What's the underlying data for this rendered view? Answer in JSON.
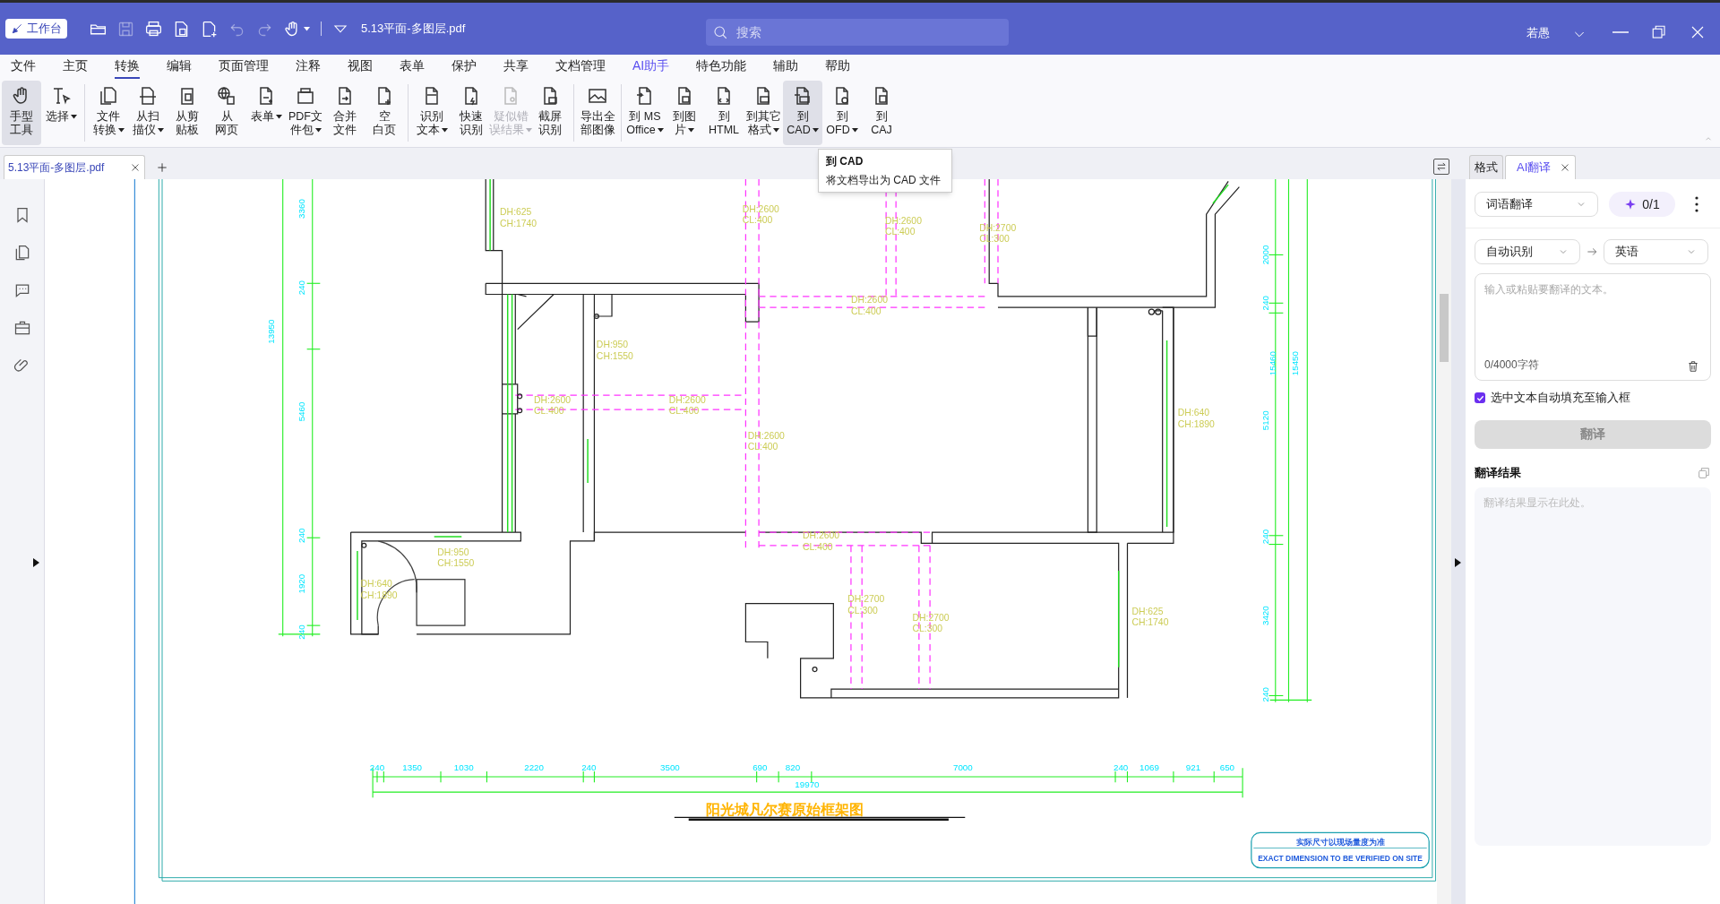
{
  "app": {
    "workbench_button": "工作台",
    "file_name": "5.13平面-多图层.pdf",
    "search": {
      "placeholder": "搜索"
    },
    "user": "若愚"
  },
  "quick_access": [
    {
      "disabled": false
    },
    {
      "disabled": true
    },
    {
      "disabled": false
    },
    {
      "disabled": false
    },
    {
      "disabled": false
    },
    {
      "disabled": true
    },
    {
      "disabled": true
    },
    {
      "disabled": false
    }
  ],
  "menu": [
    {
      "label": "文件",
      "selected": false,
      "accent": false
    },
    {
      "label": "主页",
      "selected": false,
      "accent": false
    },
    {
      "label": "转换",
      "selected": true,
      "accent": false
    },
    {
      "label": "编辑",
      "selected": false,
      "accent": false
    },
    {
      "label": "页面管理",
      "selected": false,
      "accent": false
    },
    {
      "label": "注释",
      "selected": false,
      "accent": false
    },
    {
      "label": "视图",
      "selected": false,
      "accent": false
    },
    {
      "label": "表单",
      "selected": false,
      "accent": false
    },
    {
      "label": "保护",
      "selected": false,
      "accent": false
    },
    {
      "label": "共享",
      "selected": false,
      "accent": false
    },
    {
      "label": "文档管理",
      "selected": false,
      "accent": false
    },
    {
      "label": "AI助手",
      "selected": false,
      "accent": true
    },
    {
      "label": "特色功能",
      "selected": false,
      "accent": false
    },
    {
      "label": "辅助",
      "selected": false,
      "accent": false
    },
    {
      "label": "帮助",
      "selected": false,
      "accent": false
    }
  ],
  "ribbon": [
    {
      "lines": [
        "手型",
        "工具"
      ],
      "caret": false,
      "highlighted": true,
      "disabled": false,
      "separator_before": false
    },
    {
      "lines": [
        "选择"
      ],
      "caret": true,
      "highlighted": false,
      "disabled": false,
      "separator_before": false
    },
    {
      "lines": [
        "文件",
        "转换"
      ],
      "caret": true,
      "highlighted": false,
      "disabled": false,
      "separator_before": true
    },
    {
      "lines": [
        "从扫",
        "描仪"
      ],
      "caret": true,
      "highlighted": false,
      "disabled": false,
      "separator_before": false
    },
    {
      "lines": [
        "从剪",
        "贴板"
      ],
      "caret": false,
      "highlighted": false,
      "disabled": false,
      "separator_before": false
    },
    {
      "lines": [
        "从",
        "网页"
      ],
      "caret": false,
      "highlighted": false,
      "disabled": false,
      "separator_before": false
    },
    {
      "lines": [
        "表单"
      ],
      "caret": true,
      "highlighted": false,
      "disabled": false,
      "separator_before": false
    },
    {
      "lines": [
        "PDF文",
        "件包"
      ],
      "caret": true,
      "highlighted": false,
      "disabled": false,
      "separator_before": false
    },
    {
      "lines": [
        "合并",
        "文件"
      ],
      "caret": false,
      "highlighted": false,
      "disabled": false,
      "separator_before": false
    },
    {
      "lines": [
        "空",
        "白页"
      ],
      "caret": false,
      "highlighted": false,
      "disabled": false,
      "separator_before": false
    },
    {
      "lines": [
        "识别",
        "文本"
      ],
      "caret": true,
      "highlighted": false,
      "disabled": false,
      "separator_before": true
    },
    {
      "lines": [
        "快速",
        "识别"
      ],
      "caret": false,
      "highlighted": false,
      "disabled": false,
      "separator_before": false
    },
    {
      "lines": [
        "疑似错",
        "误结果"
      ],
      "caret": true,
      "highlighted": false,
      "disabled": true,
      "separator_before": false
    },
    {
      "lines": [
        "截屏",
        "识别"
      ],
      "caret": false,
      "highlighted": false,
      "disabled": false,
      "separator_before": false
    },
    {
      "lines": [
        "导出全",
        "部图像"
      ],
      "caret": false,
      "highlighted": false,
      "disabled": false,
      "separator_before": true
    },
    {
      "lines": [
        "到 MS",
        "Office"
      ],
      "caret": true,
      "highlighted": false,
      "disabled": false,
      "separator_before": true
    },
    {
      "lines": [
        "到图",
        "片"
      ],
      "caret": true,
      "highlighted": false,
      "disabled": false,
      "separator_before": false
    },
    {
      "lines": [
        "到",
        "HTML"
      ],
      "caret": false,
      "highlighted": false,
      "disabled": false,
      "separator_before": false
    },
    {
      "lines": [
        "到其它",
        "格式"
      ],
      "caret": true,
      "highlighted": false,
      "disabled": false,
      "separator_before": false
    },
    {
      "lines": [
        "到",
        "CAD"
      ],
      "caret": true,
      "highlighted": true,
      "disabled": false,
      "separator_before": false
    },
    {
      "lines": [
        "到",
        "OFD"
      ],
      "caret": true,
      "highlighted": false,
      "disabled": false,
      "separator_before": false
    },
    {
      "lines": [
        "到",
        "CAJ"
      ],
      "caret": false,
      "highlighted": false,
      "disabled": false,
      "separator_before": false
    }
  ],
  "tooltip": {
    "title": "到 CAD",
    "text": "将文档导出为 CAD 文件"
  },
  "document_tabs": [
    {
      "label": "5.13平面-多图层.pdf",
      "selected": true
    }
  ],
  "drawing": {
    "annotations": [
      {
        "lines": [
          "DH:625",
          "CH:1740"
        ]
      },
      {
        "lines": [
          "DH:2600",
          "CL:400"
        ]
      },
      {
        "lines": [
          "DH:2600",
          "CL:400"
        ]
      },
      {
        "lines": [
          "DH:2700",
          "CL:300"
        ]
      },
      {
        "lines": [
          "DH:2600",
          "CL:400"
        ]
      },
      {
        "lines": [
          "DH:950",
          "CH:1550"
        ]
      },
      {
        "lines": [
          "DH:2600",
          "CL:400"
        ]
      },
      {
        "lines": [
          "DH:2600",
          "CL:400"
        ]
      },
      {
        "lines": [
          "DH:2600",
          "CL:400"
        ]
      },
      {
        "lines": [
          "DH:640",
          "CH:1890"
        ]
      },
      {
        "lines": [
          "DH:950",
          "CH:1550"
        ]
      },
      {
        "lines": [
          "DH:2600",
          "CL:400"
        ]
      },
      {
        "lines": [
          "DH:640",
          "CH:1890"
        ]
      },
      {
        "lines": [
          "DH:2700",
          "CL:300"
        ]
      },
      {
        "lines": [
          "DH:2700",
          "CL:300"
        ]
      },
      {
        "lines": [
          "DH:625",
          "CH:1740"
        ]
      }
    ],
    "left_dimensions": [
      "3360",
      "240",
      "13950",
      "5460",
      "240",
      "1920",
      "240"
    ],
    "right_dimensions": [
      "2000",
      "240",
      "15460",
      "15450",
      "5120",
      "240",
      "3420",
      "240"
    ],
    "bottom_dimensions": [
      "240",
      "1350",
      "1030",
      "2220",
      "240",
      "3500",
      "690",
      "820",
      "7000",
      "240",
      "1069",
      "921",
      "650"
    ],
    "total_dimension": "19970",
    "title": "阳光城凡尔赛原始框架图",
    "notice": [
      "实际尺寸以现场量度为准",
      "EXACT DIMENSION TO BE VERIFIED ON SITE"
    ]
  },
  "panel": {
    "tabs": [
      {
        "label": "格式",
        "selected": false,
        "closable": false
      },
      {
        "label": "AI翻译",
        "selected": true,
        "closable": true
      }
    ],
    "mode": "词语翻译",
    "quota": "0/1",
    "source_language": "自动识别",
    "target_language": "英语",
    "input": {
      "placeholder": "输入或粘贴要翻译的文本。"
    },
    "char_count": "0/4000字符",
    "autofill": {
      "label": "选中文本自动填充至输入框",
      "checked": true
    },
    "translate_button": {
      "label": "翻译",
      "disabled": true
    },
    "result_heading": "翻译结果",
    "result": {
      "placeholder": "翻译结果显示在此处。"
    }
  }
}
